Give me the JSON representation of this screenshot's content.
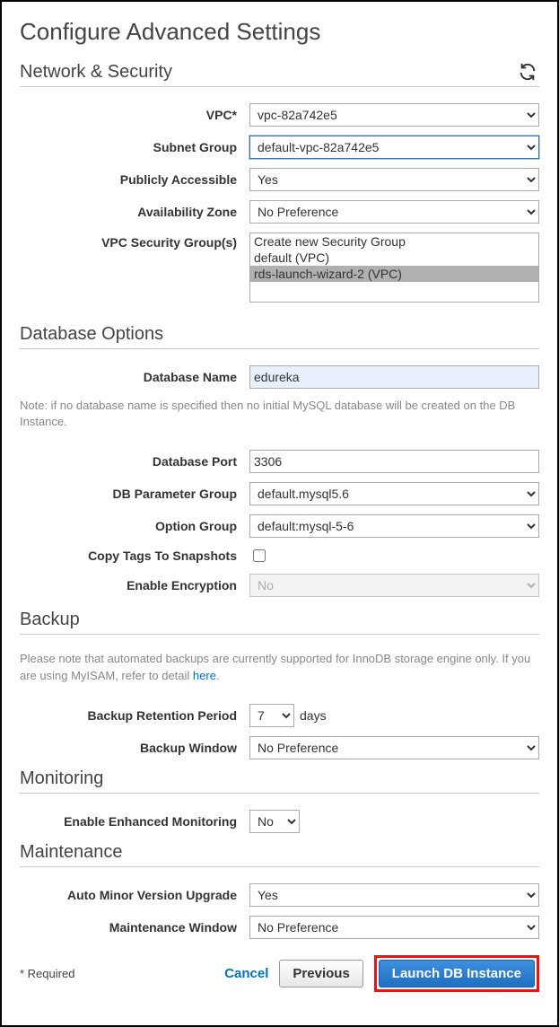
{
  "page_title": "Configure Advanced Settings",
  "sections": {
    "network": {
      "title": "Network & Security",
      "vpc": {
        "label": "VPC*",
        "value": "vpc-82a742e5"
      },
      "subnet_group": {
        "label": "Subnet Group",
        "value": "default-vpc-82a742e5"
      },
      "publicly_accessible": {
        "label": "Publicly Accessible",
        "value": "Yes"
      },
      "availability_zone": {
        "label": "Availability Zone",
        "value": "No Preference"
      },
      "security_groups": {
        "label": "VPC Security Group(s)",
        "options": [
          "Create new Security Group",
          "default (VPC)",
          "rds-launch-wizard-2 (VPC)"
        ],
        "selected_index": 2
      }
    },
    "database": {
      "title": "Database Options",
      "db_name": {
        "label": "Database Name",
        "value": "edureka"
      },
      "note": "Note: if no database name is specified then no initial MySQL database will be created on the DB Instance.",
      "db_port": {
        "label": "Database Port",
        "value": "3306"
      },
      "param_group": {
        "label": "DB Parameter Group",
        "value": "default.mysql5.6"
      },
      "option_group": {
        "label": "Option Group",
        "value": "default:mysql-5-6"
      },
      "copy_tags": {
        "label": "Copy Tags To Snapshots",
        "checked": false
      },
      "encryption": {
        "label": "Enable Encryption",
        "value": "No"
      }
    },
    "backup": {
      "title": "Backup",
      "note_prefix": "Please note that automated backups are currently supported for InnoDB storage engine only. If you are using MyISAM, refer to detail ",
      "note_link": "here",
      "note_suffix": ".",
      "retention": {
        "label": "Backup Retention Period",
        "value": "7",
        "unit": "days"
      },
      "window": {
        "label": "Backup Window",
        "value": "No Preference"
      }
    },
    "monitoring": {
      "title": "Monitoring",
      "enhanced": {
        "label": "Enable Enhanced Monitoring",
        "value": "No"
      }
    },
    "maintenance": {
      "title": "Maintenance",
      "auto_upgrade": {
        "label": "Auto Minor Version Upgrade",
        "value": "Yes"
      },
      "window": {
        "label": "Maintenance Window",
        "value": "No Preference"
      }
    }
  },
  "footer": {
    "required": "* Required",
    "cancel": "Cancel",
    "previous": "Previous",
    "launch": "Launch DB Instance"
  }
}
